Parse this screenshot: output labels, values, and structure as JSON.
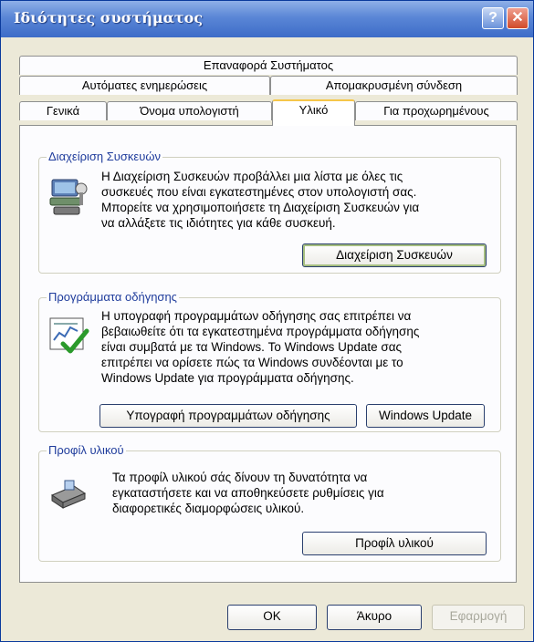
{
  "window": {
    "title": "Ιδιότητες συστήματος",
    "help_label": "?",
    "close_label": "✕"
  },
  "tabs": {
    "row1": [
      "Επαναφορά Συστήματος"
    ],
    "row2": [
      "Αυτόματες ενημερώσεις",
      "Απομακρυσμένη σύνδεση"
    ],
    "row3": [
      "Γενικά",
      "Όνομα υπολογιστή",
      "Υλικό",
      "Για προχωρημένους"
    ],
    "active": "Υλικό"
  },
  "device_manager": {
    "legend": "Διαχείριση Συσκευών",
    "lines": [
      "Η Διαχείριση Συσκευών προβάλλει μια λίστα με όλες τις",
      "συσκευές που είναι εγκατεστημένες στον υπολογιστή σας.",
      "Μπορείτε να χρησιμοποιήσετε τη Διαχείριση Συσκευών για",
      "να αλλάξετε τις ιδιότητες για κάθε συσκευή."
    ],
    "button": "Διαχείριση Συσκευών",
    "icon": "device-manager-icon"
  },
  "drivers": {
    "legend": "Προγράμματα οδήγησης",
    "lines": [
      "Η υπογραφή προγραμμάτων οδήγησης σας επιτρέπει να",
      "βεβαιωθείτε ότι τα εγκατεστημένα προγράμματα οδήγησης",
      "είναι συμβατά με τα Windows. Το Windows Update σας",
      "επιτρέπει να ορίσετε πώς τα Windows συνδέονται με το",
      "Windows Update για προγράμματα οδήγησης."
    ],
    "signing_button": "Υπογραφή προγραμμάτων οδήγησης",
    "update_button": "Windows Update",
    "icon": "driver-signing-icon"
  },
  "profiles": {
    "legend": "Προφίλ υλικού",
    "lines": [
      "Τα προφίλ υλικού σάς δίνουν τη δυνατότητα να",
      "εγκαταστήσετε και να αποθηκεύσετε ρυθμίσεις για",
      "διαφορετικές διαμορφώσεις υλικού."
    ],
    "button": "Προφίλ υλικού",
    "icon": "hardware-profile-icon"
  },
  "footer": {
    "ok": "OK",
    "cancel": "Άκυρο",
    "apply": "Εφαρμογή"
  },
  "colors": {
    "titlebar": "#3d6cc8",
    "dialog_bg": "#ece9d8",
    "group_legend": "#1f3c9c",
    "active_tab_accent": "#f5c64a"
  }
}
